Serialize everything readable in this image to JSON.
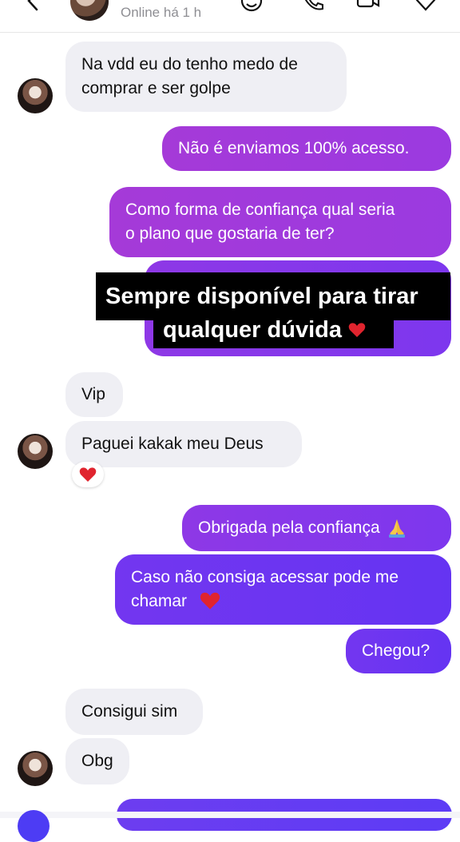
{
  "header": {
    "status": "Online há 1 h",
    "icons": [
      "back-chevron-icon",
      "contact-avatar",
      "sticker-icon",
      "phone-icon",
      "video-icon",
      "heart-outline-icon"
    ]
  },
  "messages": [
    {
      "side": "in",
      "text": "Na vdd eu do tenho medo de\ncomprar e ser golpe"
    },
    {
      "side": "out",
      "text": "Não é enviamos 100% acesso."
    },
    {
      "side": "out",
      "text": "Como forma de confiança qual seria\no plano que gostaria de ter?"
    },
    {
      "side": "out",
      "text": ""
    },
    {
      "side": "in",
      "text": "Vip"
    },
    {
      "side": "in",
      "text": "Paguei  kakak meu Deus",
      "reaction": "heart"
    },
    {
      "side": "out",
      "text": "Obrigada pela confiança",
      "emoji": "praying-hands"
    },
    {
      "side": "out",
      "text": "Caso não consiga acessar pode me\nchamar",
      "emoji": "heart"
    },
    {
      "side": "out",
      "text": "Chegou?"
    },
    {
      "side": "in",
      "text": "Consigui sim"
    },
    {
      "side": "in",
      "text": "Obg"
    }
  ],
  "overlay": {
    "line1": "Sempre disponível para tirar",
    "line2": "qualquer dúvida"
  },
  "colors": {
    "bubble_in": "#efeff4",
    "purple_top": "#a53ad8",
    "purple_mid": "#8e38e6",
    "purple_bottom": "#6534f2",
    "heart": "#e0242e"
  }
}
